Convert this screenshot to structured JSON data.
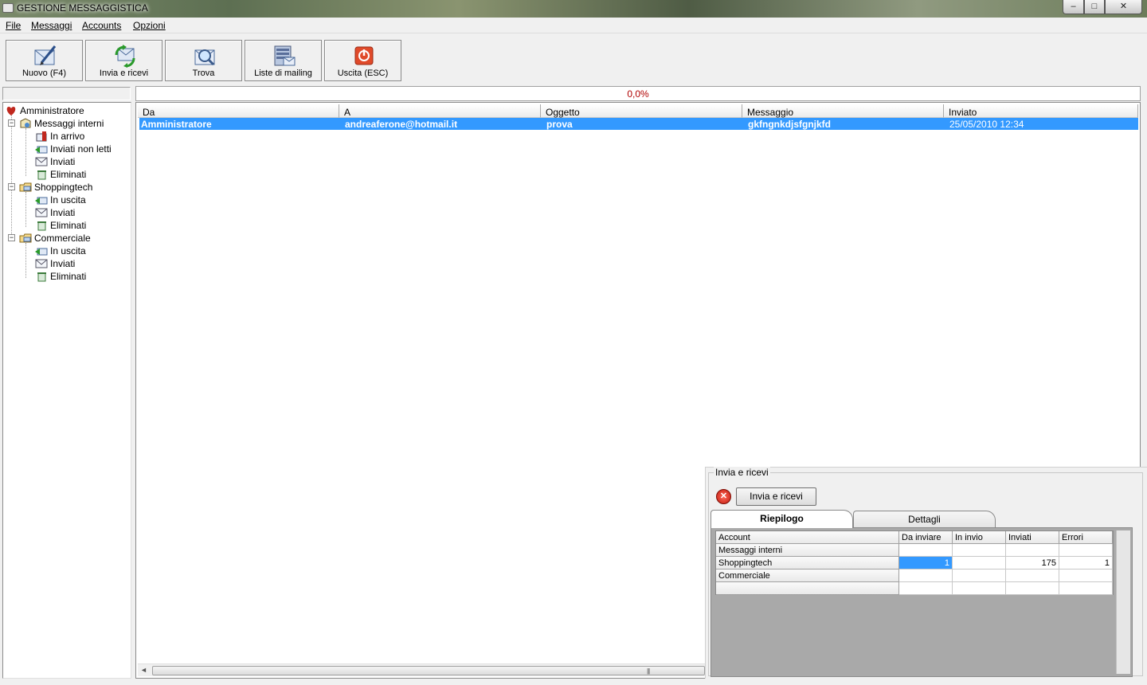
{
  "window": {
    "title": "GESTIONE MESSAGGISTICA",
    "min": "–",
    "max": "□",
    "close": "✕"
  },
  "menu": [
    "File",
    "Messaggi",
    "Accounts",
    "Opzioni"
  ],
  "toolbar": [
    {
      "label": "Nuovo (F4)",
      "icon": "new-message-icon"
    },
    {
      "label": "Invia e ricevi",
      "icon": "send-receive-icon"
    },
    {
      "label": "Trova",
      "icon": "search-icon"
    },
    {
      "label": "Liste di mailing",
      "icon": "mailing-list-icon"
    },
    {
      "label": "Uscita (ESC)",
      "icon": "exit-icon"
    }
  ],
  "progress": {
    "text": "0,0%",
    "value": 0
  },
  "tree": {
    "root": "Amministratore",
    "groups": [
      {
        "label": "Messaggi interni",
        "children": [
          "In arrivo",
          "Inviati non letti",
          "Inviati",
          "Eliminati"
        ]
      },
      {
        "label": "Shoppingtech",
        "children": [
          "In uscita",
          "Inviati",
          "Eliminati"
        ]
      },
      {
        "label": "Commerciale",
        "children": [
          "In uscita",
          "Inviati",
          "Eliminati"
        ]
      }
    ]
  },
  "messages": {
    "columns": [
      "Da",
      "A",
      "Oggetto",
      "Messaggio",
      "Inviato"
    ],
    "rows": [
      [
        "Amministratore",
        "andreaferone@hotmail.it",
        "prova",
        "gkfngnkdjsfgnjkfd",
        "25/05/2010 12:34"
      ]
    ]
  },
  "send_panel": {
    "title": "Invia e ricevi",
    "button": "Invia e ricevi",
    "tabs": [
      "Riepilogo",
      "Dettagli"
    ],
    "columns": [
      "Account",
      "Da inviare",
      "In invio",
      "Inviati",
      "Errori"
    ],
    "rows": [
      [
        "Messaggi interni",
        "",
        "",
        "",
        ""
      ],
      [
        "Shoppingtech",
        "1",
        "",
        "175",
        "1"
      ],
      [
        "Commerciale",
        "",
        "",
        "",
        ""
      ],
      [
        "",
        "",
        "",
        "",
        ""
      ]
    ]
  },
  "colors": {
    "selection": "#3399ff",
    "progress_text": "#b00000"
  }
}
